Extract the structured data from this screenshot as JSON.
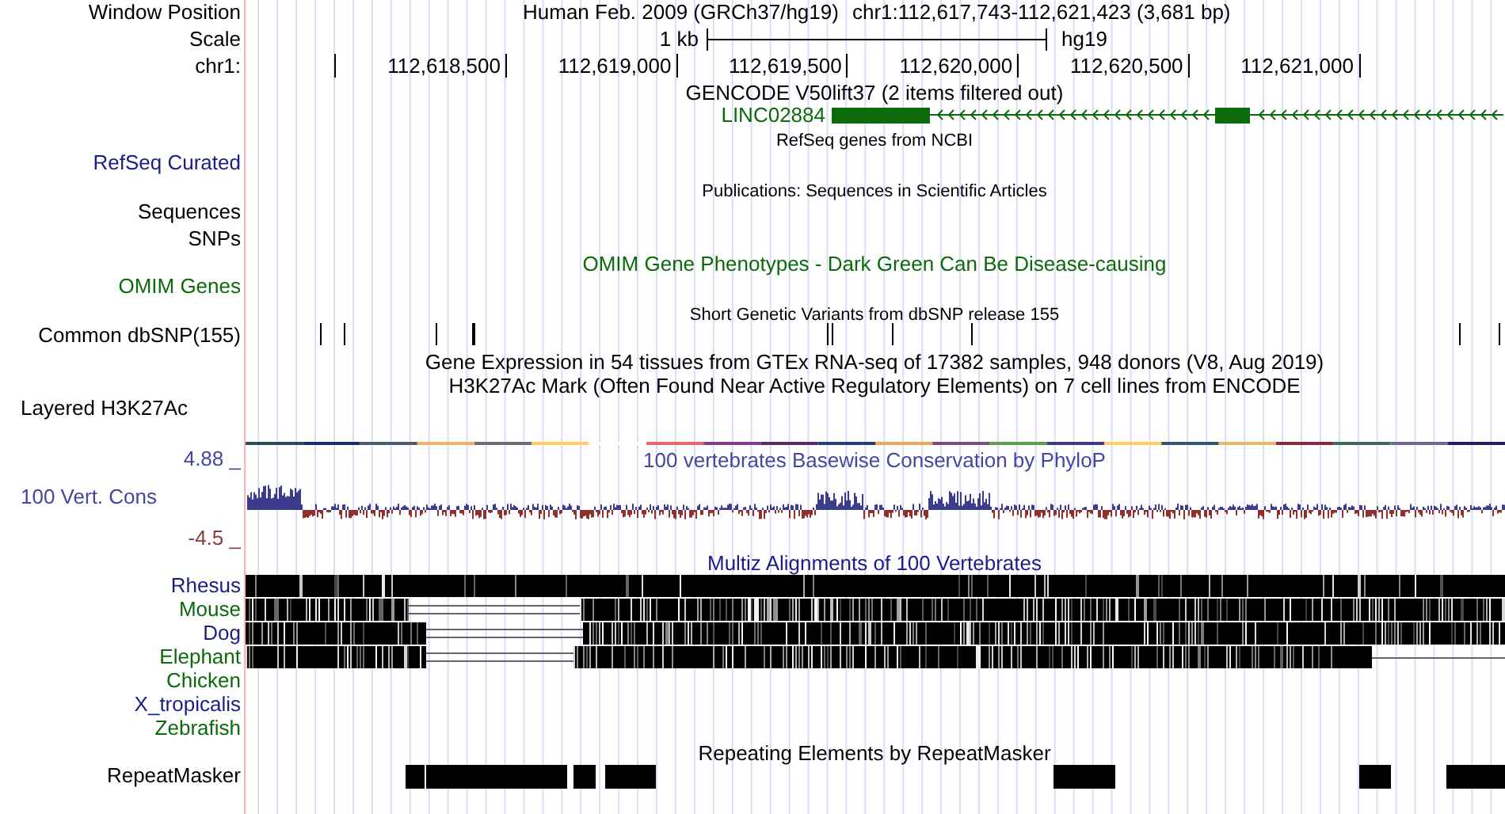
{
  "header": {
    "assembly": "Human Feb. 2009 (GRCh37/hg19)",
    "position": "chr1:112,617,743-112,621,423 (3,681 bp)"
  },
  "scale": {
    "length": "1 kb",
    "assembly": "hg19"
  },
  "ruler": {
    "ticks": [
      "112,618,500",
      "112,619,000",
      "112,619,500",
      "112,620,000",
      "112,620,500",
      "112,621,000"
    ]
  },
  "gene": {
    "name": "LINC02884",
    "reverse_strand": true
  },
  "track_labels": [
    {
      "text": "Window Position",
      "color": "#000000"
    },
    {
      "text": "Scale",
      "color": "#000000"
    },
    {
      "text": "chr1:",
      "color": "#000000"
    },
    {
      "text": "RefSeq Curated",
      "color": "#1c1c86"
    },
    {
      "text": "Sequences",
      "color": "#000000"
    },
    {
      "text": "SNPs",
      "color": "#000000"
    },
    {
      "text": "OMIM Genes",
      "color": "#0b6a0b"
    },
    {
      "text": "Common dbSNP(155)",
      "color": "#000000"
    },
    {
      "text": "Layered H3K27Ac",
      "color": "#000000"
    },
    {
      "text": "4.88 _",
      "color": "#4646a0"
    },
    {
      "text": "100 Vert. Cons",
      "color": "#4646a0"
    },
    {
      "text": "-4.5 _",
      "color": "#8c3c3c"
    },
    {
      "text": "Rhesus",
      "color": "#1c1c86"
    },
    {
      "text": "Mouse",
      "color": "#0b6a0b"
    },
    {
      "text": "Dog",
      "color": "#1c1c86"
    },
    {
      "text": "Elephant",
      "color": "#0b6a0b"
    },
    {
      "text": "Chicken",
      "color": "#0b6a0b"
    },
    {
      "text": "X_tropicalis",
      "color": "#1c1c86"
    },
    {
      "text": "Zebrafish",
      "color": "#0b6a0b"
    },
    {
      "text": "RepeatMasker",
      "color": "#000000"
    }
  ],
  "track_titles": [
    {
      "text": "GENCODE V50lift37 (2 items filtered out)",
      "color": "#000000"
    },
    {
      "text": "RefSeq genes from NCBI",
      "color": "#000000"
    },
    {
      "text": "Publications: Sequences in Scientific Articles",
      "color": "#000000"
    },
    {
      "text": "OMIM Gene Phenotypes - Dark Green Can Be Disease-causing",
      "color": "#0b6a0b"
    },
    {
      "text": "Short Genetic Variants from dbSNP release 155",
      "color": "#000000"
    },
    {
      "text": "Gene Expression in 54 tissues from GTEx RNA-seq of 17382 samples, 948 donors (V8, Aug 2019)",
      "color": "#000000"
    },
    {
      "text": "H3K27Ac Mark (Often Found Near Active Regulatory Elements) on 7 cell lines from ENCODE",
      "color": "#000000"
    },
    {
      "text": "100 vertebrates Basewise Conservation by PhyloP",
      "color": "#4646a0"
    },
    {
      "text": "Multiz Alignments of 100 Vertebrates",
      "color": "#1c1c86"
    },
    {
      "text": "Repeating Elements by RepeatMasker",
      "color": "#000000"
    }
  ]
}
